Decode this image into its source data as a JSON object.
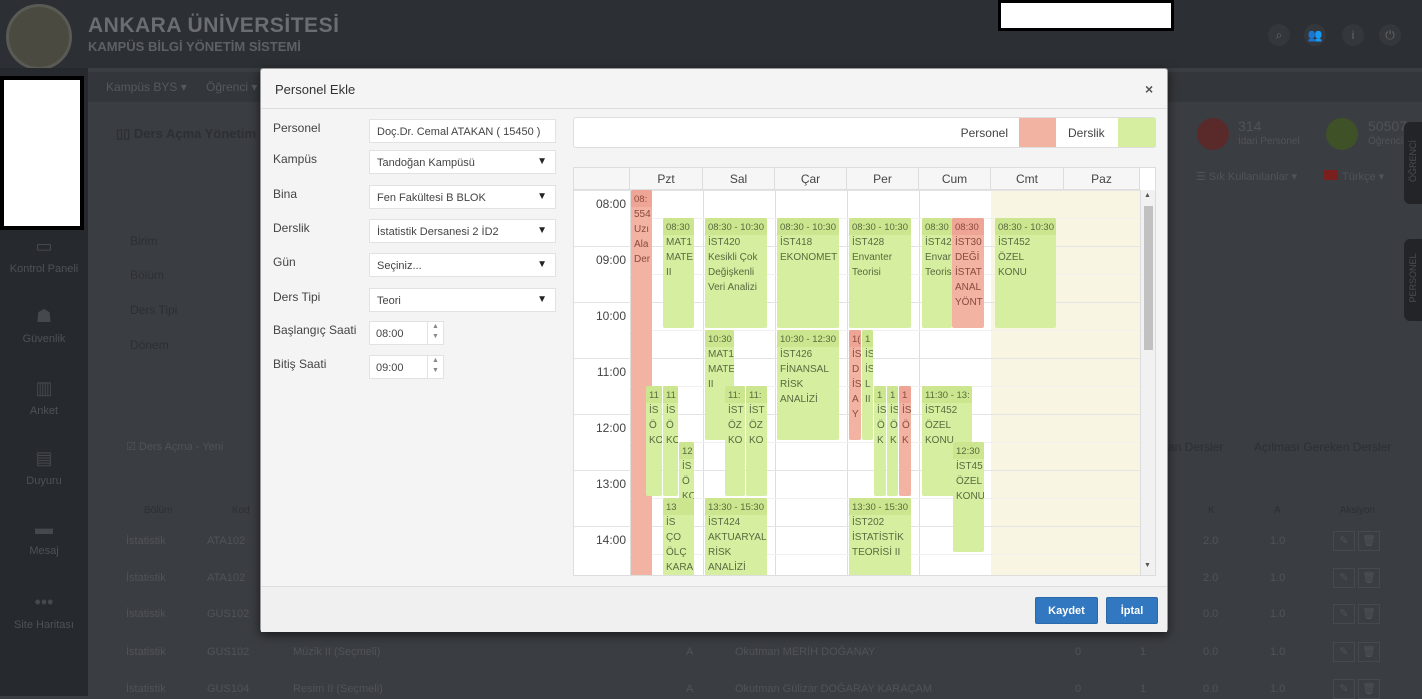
{
  "header": {
    "brand_title": "ANKARA ÜNİVERSİTESİ",
    "brand_subtitle": "KAMPÜS BİLGİ YÖNETİM SİSTEMİ"
  },
  "nav": {
    "items": [
      "Kampüs BYS ▾",
      "Öğrenci ▾"
    ]
  },
  "sidebar": {
    "items": [
      {
        "label": "Kontrol Paneli",
        "icon": "monitor-icon"
      },
      {
        "label": "Güvenlik",
        "icon": "users-icon"
      },
      {
        "label": "Anket",
        "icon": "bar-chart-icon"
      },
      {
        "label": "Duyuru",
        "icon": "newspaper-icon"
      },
      {
        "label": "Mesaj",
        "icon": "chat-icon"
      },
      {
        "label": "Site Haritası",
        "icon": "dots-icon"
      }
    ]
  },
  "background": {
    "page_title": "Ders Açma Yönetim",
    "filters": [
      "Birim",
      "Bölüm",
      "Ders Tipi",
      "Dönem"
    ],
    "stats": [
      {
        "value": "314",
        "label": "İdari Personel",
        "color": "#5a2a2a"
      },
      {
        "value": "50507",
        "label": "Öğrenci",
        "color": "#3f5227"
      }
    ],
    "favorites": "Sık Kullanılanlar ▾",
    "language": "Türkçe ▾",
    "side_tabs": [
      "ÖĞRENCİ",
      "PERSONEL"
    ],
    "new_button": "Ders Açma - Yeni",
    "tabs": [
      "an Dersler",
      "Açılması Gereken Dersler"
    ],
    "table_headers": [
      "Bölüm",
      "Kod",
      "K",
      "A",
      "Aksiyon"
    ],
    "rows": [
      {
        "bolum": "İstatistik",
        "kod": "ATA102",
        "ad": "",
        "sube": "",
        "okutman": "",
        "t": "",
        "u": "",
        "k": "2.0",
        "a": "1.0"
      },
      {
        "bolum": "İstatistik",
        "kod": "ATA102",
        "ad": "",
        "sube": "",
        "okutman": "",
        "t": "",
        "u": "",
        "k": "2.0",
        "a": "1.0"
      },
      {
        "bolum": "İstatistik",
        "kod": "GUS102",
        "ad": "",
        "sube": "",
        "okutman": "",
        "t": "",
        "u": "",
        "k": "0.0",
        "a": "1.0"
      },
      {
        "bolum": "İstatistik",
        "kod": "GUS102",
        "ad": "Müzik II (Seçmeli)",
        "sube": "A",
        "okutman": "Okutman MERİH DOĞANAY",
        "t": "0",
        "u": "1",
        "k": "0.0",
        "a": "1.0"
      },
      {
        "bolum": "İstatistik",
        "kod": "GUS104",
        "ad": "Resim II (Seçmeli)",
        "sube": "A",
        "okutman": "Okutman Gülizar DOĞARAY KARAÇAM",
        "t": "0",
        "u": "1",
        "k": "0.0",
        "a": "1.0"
      }
    ]
  },
  "modal": {
    "title": "Personel Ekle",
    "close": "×",
    "form": [
      {
        "label": "Personel",
        "value": "Doç.Dr. Cemal ATAKAN ( 15450 )",
        "type": "text"
      },
      {
        "label": "Kampüs",
        "value": "Tandoğan Kampüsü",
        "type": "select"
      },
      {
        "label": "Bina",
        "value": "Fen Fakültesi B BLOK",
        "type": "select"
      },
      {
        "label": "Derslik",
        "value": "İstatistik Dersanesi 2 İD2",
        "type": "select"
      },
      {
        "label": "Gün",
        "value": "Seçiniz...",
        "type": "select"
      },
      {
        "label": "Ders Tipi",
        "value": "Teori",
        "type": "select"
      },
      {
        "label": "Başlangıç Saati",
        "value": "08:00",
        "type": "time"
      },
      {
        "label": "Bitiş Saati",
        "value": "09:00",
        "type": "time"
      }
    ],
    "legend": {
      "personel_label": "Personel",
      "personel_color": "#f2b3a3",
      "derslik_label": "Derslik",
      "derslik_color": "#d6ee9f"
    },
    "calendar": {
      "days": [
        "Pzt",
        "Sal",
        "Çar",
        "Per",
        "Cum",
        "Cmt",
        "Paz"
      ],
      "hours": [
        "08:00",
        "09:00",
        "10:00",
        "11:00",
        "12:00",
        "13:00",
        "14:00"
      ],
      "events": [
        {
          "day": "Pzt",
          "type": "personel",
          "start": "08:00",
          "end": "15:30",
          "time": "08:",
          "lines": [
            "554",
            "Uzı",
            "Ala",
            "Der"
          ]
        },
        {
          "day": "Pzt",
          "type": "derslik",
          "start": "08:30",
          "end": "10:30",
          "time": "08:30",
          "lines": [
            "MAT1",
            "MATE",
            "II"
          ]
        },
        {
          "day": "Pzt",
          "type": "derslik",
          "start": "11:30",
          "end": "13:30",
          "time": "11",
          "lines": [
            "İS",
            "Ö",
            "KO"
          ]
        },
        {
          "day": "Pzt",
          "type": "derslik",
          "start": "11:30",
          "end": "13:30",
          "time": "11",
          "lines": [
            "İS",
            "Ö",
            "KO"
          ]
        },
        {
          "day": "Pzt",
          "type": "derslik",
          "start": "12:30",
          "end": "14:30",
          "time": "12",
          "lines": [
            "İS",
            "Ö",
            "KO"
          ]
        },
        {
          "day": "Pzt",
          "type": "derslik",
          "start": "13:30",
          "end": "15:30",
          "time": "13",
          "lines": [
            "İS",
            "ÇO",
            "ÖLÇ",
            "KARA"
          ]
        },
        {
          "day": "Sal",
          "type": "derslik",
          "start": "08:30",
          "end": "10:30",
          "time": "08:30 - 10:30",
          "lines": [
            "İST420",
            "Kesikli Çok",
            "Değişkenli",
            "Veri Analizi"
          ]
        },
        {
          "day": "Sal",
          "type": "derslik",
          "start": "10:30",
          "end": "12:30",
          "time": "10:30",
          "lines": [
            "MAT1",
            "MATE",
            "II"
          ]
        },
        {
          "day": "Sal",
          "type": "derslik",
          "start": "11:30",
          "end": "13:30",
          "time": "11:",
          "lines": [
            "İST",
            "ÖZ",
            "KO"
          ]
        },
        {
          "day": "Sal",
          "type": "derslik",
          "start": "11:30",
          "end": "13:30",
          "time": "11:",
          "lines": [
            "İST",
            "ÖZ",
            "KO"
          ]
        },
        {
          "day": "Sal",
          "type": "derslik",
          "start": "13:30",
          "end": "15:30",
          "time": "13:30 - 15:30",
          "lines": [
            "İST424",
            "AKTUARYAL",
            "RİSK",
            "ANALİZİ"
          ]
        },
        {
          "day": "Çar",
          "type": "derslik",
          "start": "08:30",
          "end": "10:30",
          "time": "08:30 - 10:30",
          "lines": [
            "İST418",
            "EKONOMET"
          ]
        },
        {
          "day": "Çar",
          "type": "derslik",
          "start": "10:30",
          "end": "12:30",
          "time": "10:30 - 12:30",
          "lines": [
            "İST426",
            "FİNANSAL",
            "RİSK",
            "ANALİZİ"
          ]
        },
        {
          "day": "Per",
          "type": "derslik",
          "start": "08:30",
          "end": "10:30",
          "time": "08:30 - 10:30",
          "lines": [
            "İST428",
            "Envanter",
            "Teorisi"
          ]
        },
        {
          "day": "Per",
          "type": "personel",
          "start": "10:30",
          "end": "12:30",
          "time": "1(",
          "lines": [
            "İS",
            "D",
            "İS",
            "A",
            "Y"
          ]
        },
        {
          "day": "Per",
          "type": "derslik",
          "start": "10:30",
          "end": "12:30",
          "time": "1",
          "lines": [
            "İS",
            "İS",
            "L",
            "II"
          ]
        },
        {
          "day": "Per",
          "type": "derslik",
          "start": "11:30",
          "end": "13:30",
          "time": "1",
          "lines": [
            "İS",
            "Ö",
            "K"
          ]
        },
        {
          "day": "Per",
          "type": "derslik",
          "start": "11:30",
          "end": "13:30",
          "time": "1",
          "lines": [
            "İS",
            "Ö",
            "K"
          ]
        },
        {
          "day": "Per",
          "type": "personel",
          "start": "11:30",
          "end": "13:30",
          "time": "1",
          "lines": [
            "İS",
            "Ö",
            "K"
          ]
        },
        {
          "day": "Per",
          "type": "derslik",
          "start": "13:30",
          "end": "15:30",
          "time": "13:30 - 15:30",
          "lines": [
            "İST202",
            "İSTATİSTİK",
            "TEORİSİ II"
          ]
        },
        {
          "day": "Cum",
          "type": "derslik",
          "start": "08:30",
          "end": "10:30",
          "time": "08:30",
          "lines": [
            "İST42",
            "Envar",
            "Teoris"
          ]
        },
        {
          "day": "Cum",
          "type": "personel",
          "start": "08:30",
          "end": "10:30",
          "time": "08:30",
          "lines": [
            "İST30",
            "DEĞİ",
            "İSTAT",
            "ANAL",
            "YÖNT"
          ]
        },
        {
          "day": "Cum",
          "type": "derslik",
          "start": "11:30",
          "end": "13:30",
          "time": "11:30 - 13:",
          "lines": [
            "İST452",
            "ÖZEL",
            "KONU"
          ]
        },
        {
          "day": "Cum",
          "type": "derslik",
          "start": "12:30",
          "end": "14:30",
          "time": "12:30",
          "lines": [
            "İST45",
            "ÖZEL",
            "KONU"
          ]
        },
        {
          "day": "Cmt",
          "type": "derslik",
          "start": "08:30",
          "end": "10:30",
          "time": "08:30 - 10:30",
          "lines": [
            "İST452",
            "ÖZEL",
            "KONU"
          ]
        }
      ]
    },
    "buttons": {
      "save": "Kaydet",
      "cancel": "İptal"
    }
  }
}
